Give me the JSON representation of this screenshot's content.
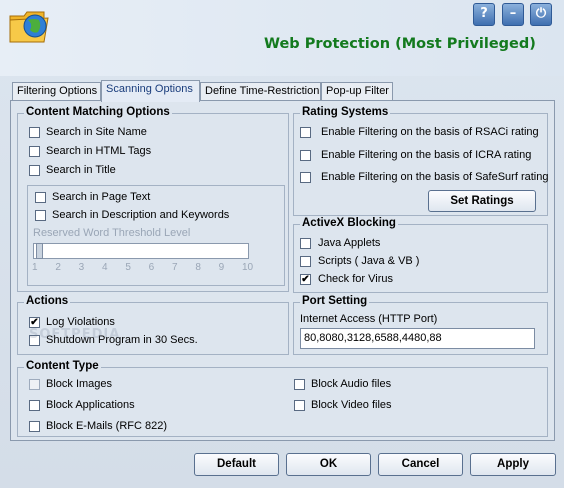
{
  "window": {
    "title": "Web Protection (Most Privileged)",
    "buttons": {
      "help": "?",
      "minimize": "–",
      "power": "⏻"
    },
    "accent_title_color": "#137a1e"
  },
  "tabs": [
    {
      "label": "Filtering Options",
      "active": false
    },
    {
      "label": "Scanning Options",
      "active": true
    },
    {
      "label": "Define Time-Restriction",
      "active": false
    },
    {
      "label": "Pop-up Filter",
      "active": false
    }
  ],
  "content_matching": {
    "title": "Content Matching Options",
    "items": [
      {
        "label": "Search in Site Name",
        "checked": false
      },
      {
        "label": "Search in HTML Tags",
        "checked": false
      },
      {
        "label": "Search in Title",
        "checked": false
      },
      {
        "label": "Search in Page Text",
        "checked": false
      },
      {
        "label": "Search in Description and Keywords",
        "checked": false
      }
    ],
    "threshold_label": "Reserved Word Threshold Level",
    "threshold_ticks": [
      "1",
      "2",
      "3",
      "4",
      "5",
      "6",
      "7",
      "8",
      "9",
      "10"
    ],
    "threshold_value": 1
  },
  "rating": {
    "title": "Rating Systems",
    "items": [
      {
        "label": "Enable Filtering on the basis of RSACi rating",
        "checked": false
      },
      {
        "label": "Enable Filtering on the basis of ICRA rating",
        "checked": false
      },
      {
        "label": "Enable Filtering on the basis of SafeSurf rating",
        "checked": false
      }
    ],
    "set_ratings_label": "Set Ratings"
  },
  "activex": {
    "title": "ActiveX Blocking",
    "items": [
      {
        "label": "Java Applets",
        "checked": false
      },
      {
        "label": "Scripts ( Java & VB )",
        "checked": false
      },
      {
        "label": "Check for Virus",
        "checked": true
      }
    ]
  },
  "actions": {
    "title": "Actions",
    "items": [
      {
        "label": "Log Violations",
        "checked": true
      },
      {
        "label": "Shutdown Program in 30 Secs.",
        "checked": false
      }
    ]
  },
  "port": {
    "title": "Port Setting",
    "label": "Internet Access (HTTP Port)",
    "value": "80,8080,3128,6588,4480,88"
  },
  "content_type": {
    "title": "Content Type",
    "left": [
      {
        "label": "Block Images",
        "checked": false,
        "disabled": true
      },
      {
        "label": "Block Applications",
        "checked": false,
        "disabled": false
      },
      {
        "label": "Block E-Mails (RFC 822)",
        "checked": false,
        "disabled": false
      }
    ],
    "right": [
      {
        "label": "Block Audio files",
        "checked": false,
        "disabled": false
      },
      {
        "label": "Block Video files",
        "checked": false,
        "disabled": false
      }
    ]
  },
  "footer": {
    "default": "Default",
    "ok": "OK",
    "cancel": "Cancel",
    "apply": "Apply"
  },
  "watermark": "SOFTPEDIA",
  "icons": [
    "folder-globe-icon",
    "help-icon",
    "minimize-icon",
    "power-icon"
  ]
}
